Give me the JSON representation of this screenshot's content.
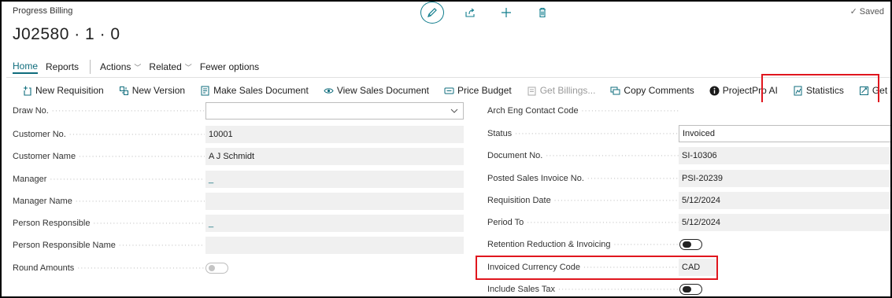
{
  "header": {
    "breadcrumb": "Progress Billing",
    "record_title": "J02580 · 1 · 0",
    "saved_label": "Saved"
  },
  "menu": {
    "home": "Home",
    "reports": "Reports",
    "actions": "Actions",
    "related": "Related",
    "fewer": "Fewer options"
  },
  "toolbar": {
    "new_requisition": "New Requisition",
    "new_version": "New Version",
    "make_sales_document": "Make Sales Document",
    "view_sales_document": "View Sales Document",
    "price_budget": "Price Budget",
    "get_billings": "Get Billings...",
    "copy_comments": "Copy Comments",
    "projectpro_ai": "ProjectPro AI",
    "statistics": "Statistics",
    "get_job_planning_lines": "Get Job Planning Lines"
  },
  "left_fields": {
    "draw_no": {
      "label": "Draw No.",
      "value": ""
    },
    "customer_no": {
      "label": "Customer No.",
      "value": "10001"
    },
    "customer_name": {
      "label": "Customer Name",
      "value": "A J Schmidt"
    },
    "manager": {
      "label": "Manager",
      "value": "_"
    },
    "manager_name": {
      "label": "Manager Name",
      "value": ""
    },
    "person_responsible": {
      "label": "Person Responsible",
      "value": "_"
    },
    "person_responsible_name": {
      "label": "Person Responsible Name",
      "value": ""
    },
    "round_amounts": {
      "label": "Round Amounts",
      "value": false
    }
  },
  "right_fields": {
    "arch_eng_contact_code": {
      "label": "Arch Eng Contact Code",
      "value": ""
    },
    "status": {
      "label": "Status",
      "value": "Invoiced"
    },
    "document_no": {
      "label": "Document No.",
      "value": "SI-10306"
    },
    "posted_sales_invoice_no": {
      "label": "Posted Sales Invoice No.",
      "value": "PSI-20239"
    },
    "requisition_date": {
      "label": "Requisition Date",
      "value": "5/12/2024"
    },
    "period_to": {
      "label": "Period To",
      "value": "5/12/2024"
    },
    "retention_reduction": {
      "label": "Retention Reduction & Invoicing",
      "value": false
    },
    "invoiced_currency_code": {
      "label": "Invoiced Currency Code",
      "value": "CAD"
    },
    "include_sales_tax": {
      "label": "Include Sales Tax",
      "value": false
    }
  },
  "colors": {
    "accent": "#0f6c7c",
    "highlight": "#e0161e"
  }
}
